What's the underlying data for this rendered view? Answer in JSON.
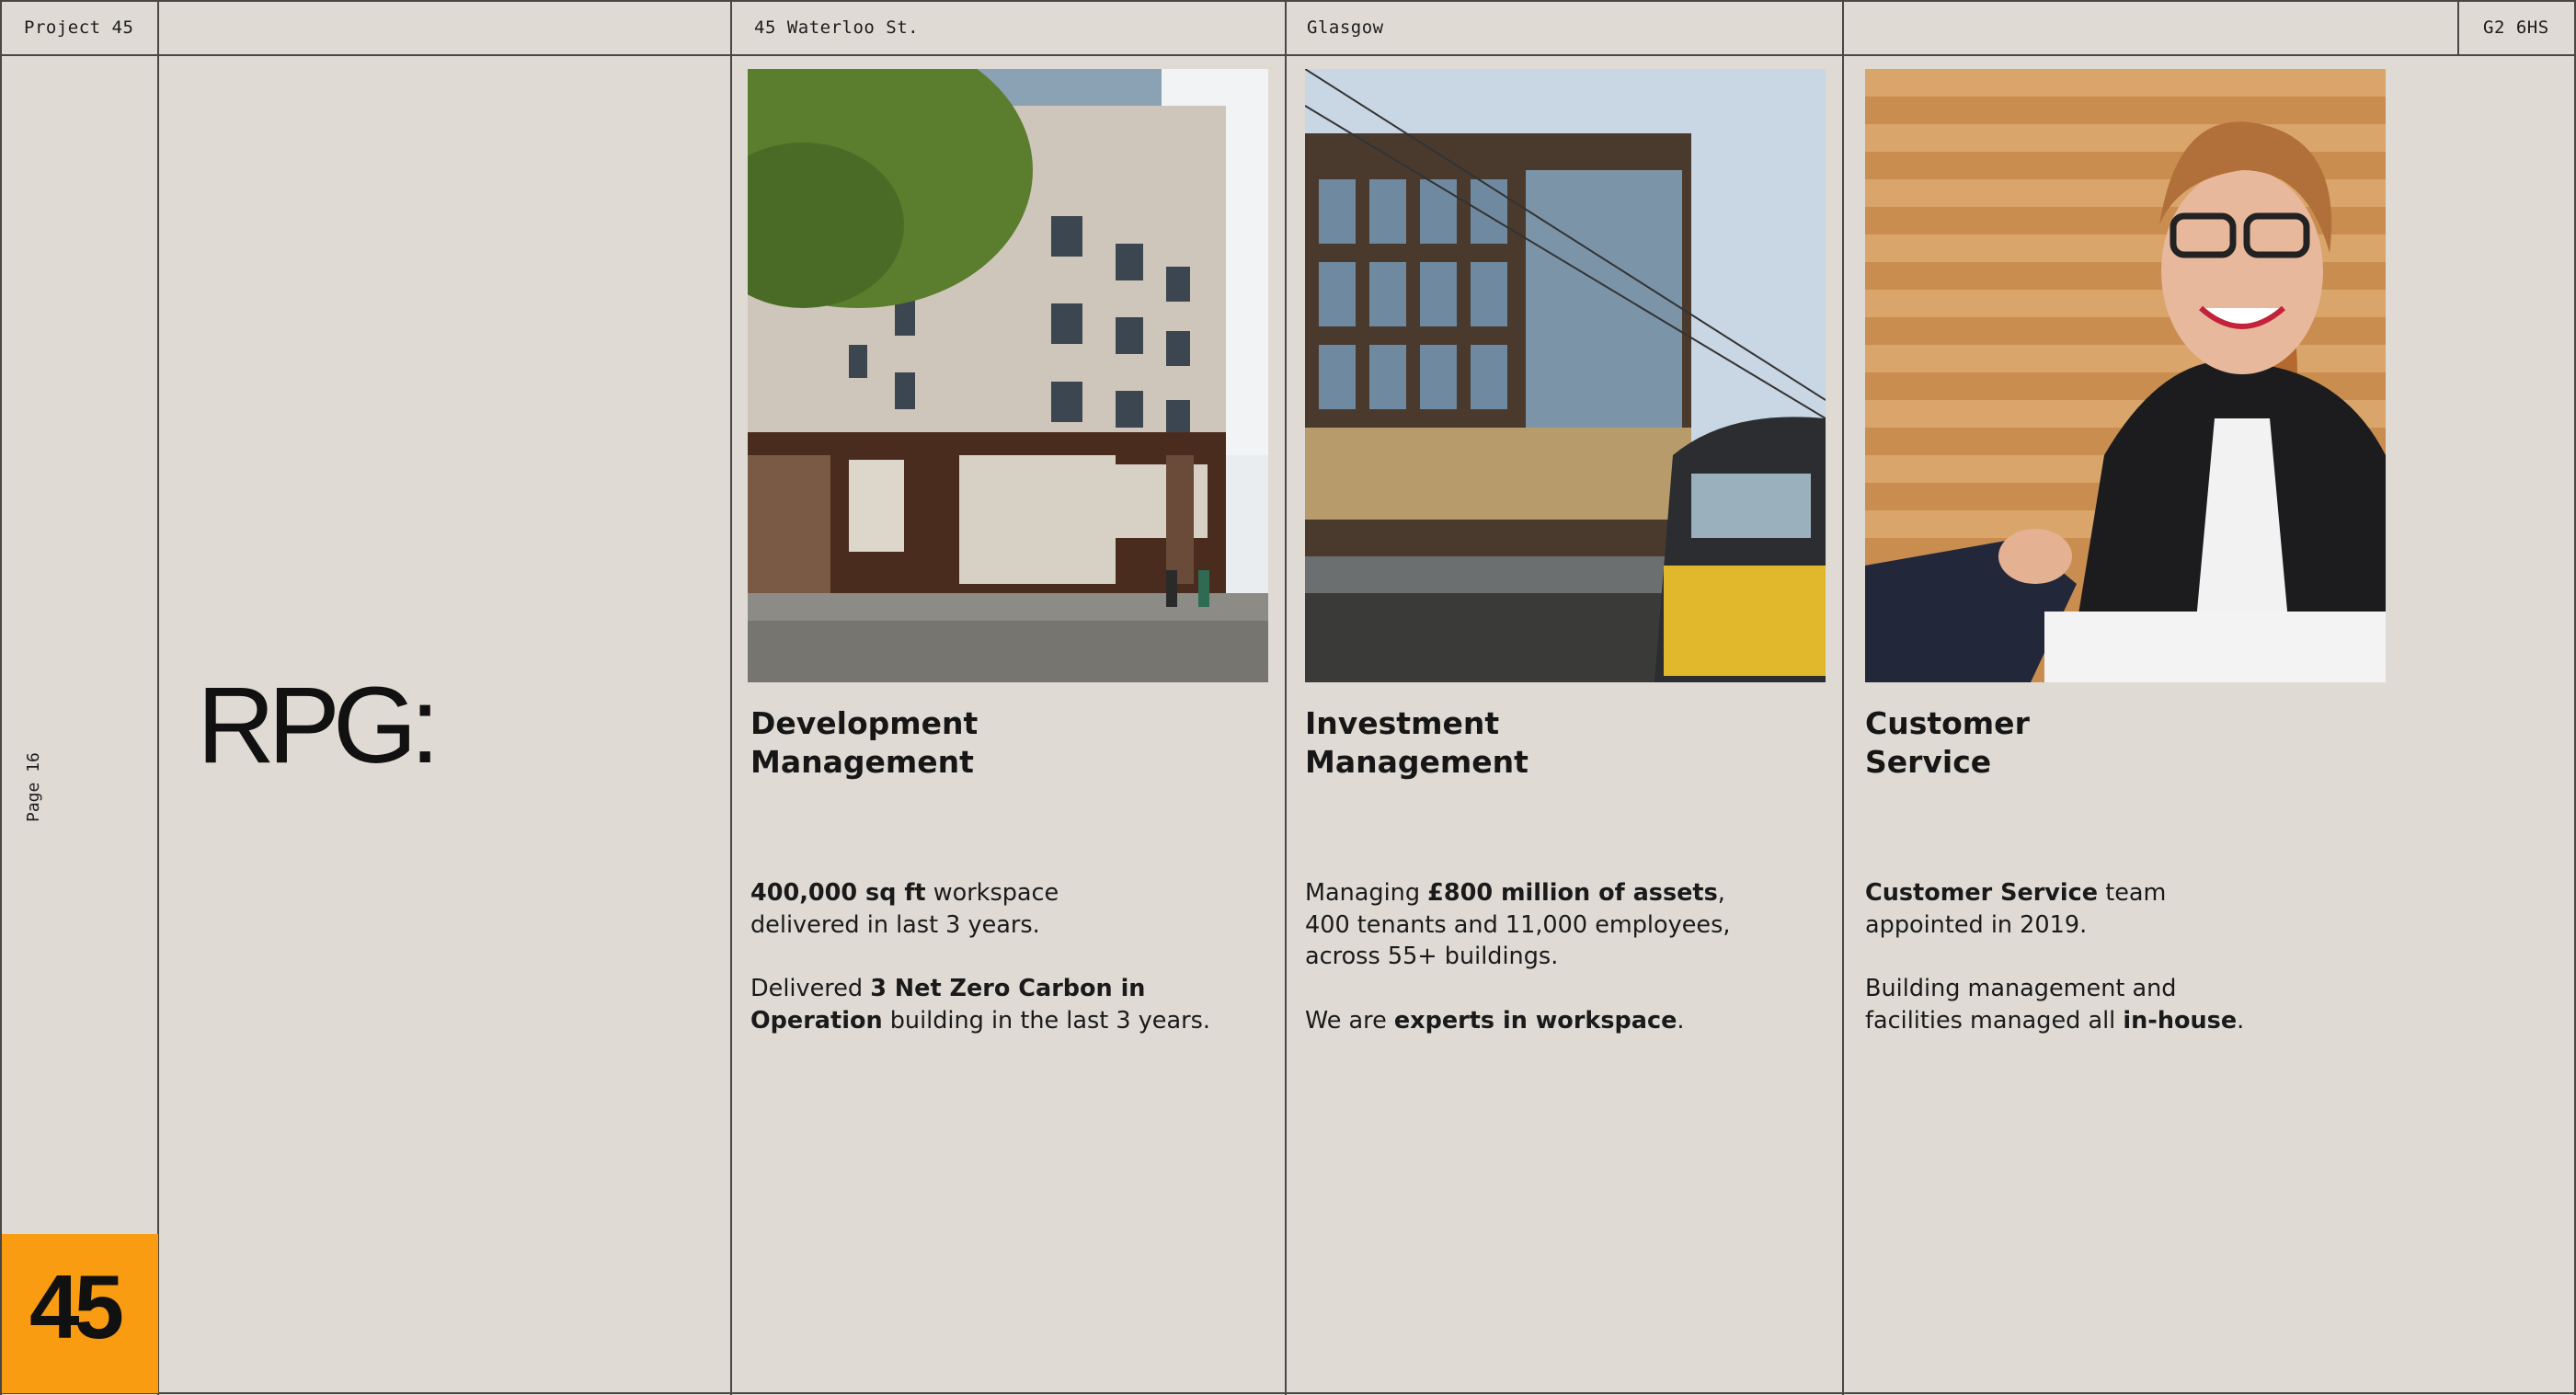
{
  "header": {
    "project": "Project 45",
    "address": "45 Waterloo St.",
    "city": "Glasgow",
    "postcode": "G2 6HS"
  },
  "side": {
    "page_label": "Page 16",
    "badge_number": "45",
    "badge_color": "#f99c12"
  },
  "logo": {
    "text": "RPG:"
  },
  "columns": [
    {
      "image": "office-building-photo",
      "title_line1": "Development",
      "title_line2": "Management",
      "p1": {
        "bold": "400,000 sq ft",
        "rest": " workspace",
        "line2": "delivered in last 3 years."
      },
      "p2": {
        "pre": "Delivered ",
        "bold1": "3 Net Zero Carbon in",
        "bold2": "Operation",
        "post": " building in the last 3 years."
      }
    },
    {
      "image": "glass-office-and-train-photo",
      "title_line1": "Investment",
      "title_line2": "Management",
      "p1": {
        "pre": "Managing ",
        "bold": "£800 million of assets",
        "post": ",",
        "line2": "400 tenants and 11,000 employees,",
        "line3": "across 55+ buildings."
      },
      "p2": {
        "pre": "We are ",
        "bold": "experts in workspace",
        "post": "."
      }
    },
    {
      "image": "customer-service-handshake-photo",
      "title_line1": "Customer",
      "title_line2": "Service",
      "p1": {
        "bold": "Customer Service",
        "rest": " team",
        "line2": "appointed in 2019."
      },
      "p2": {
        "line1": "Building management and",
        "pre": "facilities managed all ",
        "bold": "in-house",
        "post": "."
      }
    }
  ]
}
